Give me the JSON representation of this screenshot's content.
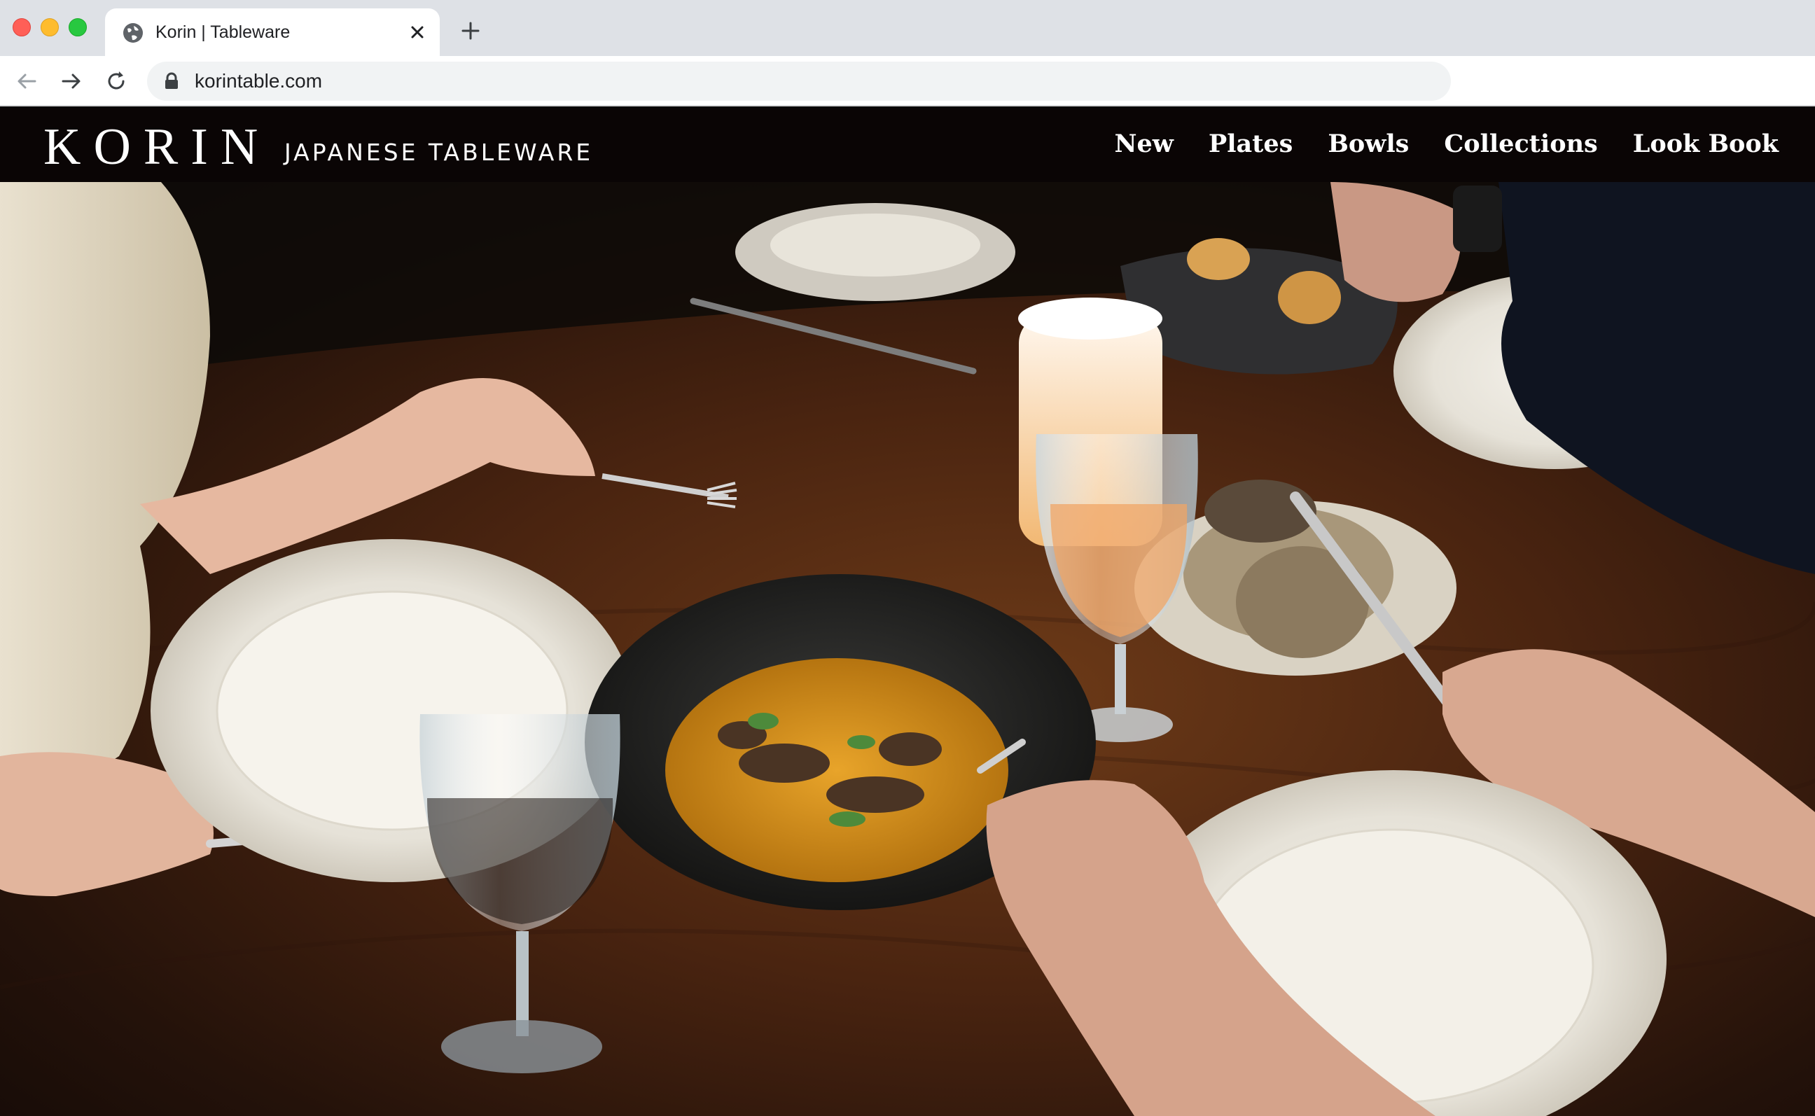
{
  "browser": {
    "tab_title": "Korin | Tableware",
    "url": "korintable.com"
  },
  "site": {
    "logo": "KORIN",
    "tagline": "JAPANESE TABLEWARE",
    "nav": [
      "New",
      "Plates",
      "Bowls",
      "Collections",
      "Look Book"
    ]
  },
  "colors": {
    "header_bg": "#0a0505",
    "chrome_bg": "#dee1e6"
  }
}
